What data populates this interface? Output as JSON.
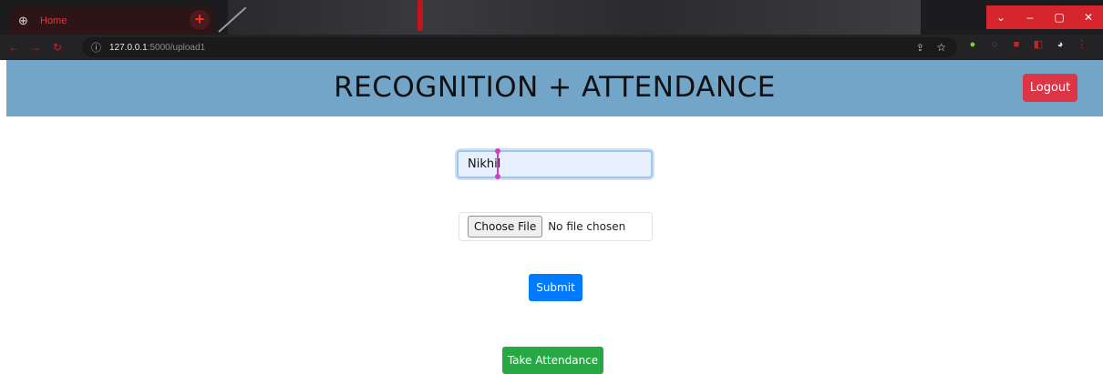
{
  "browser": {
    "tab_title": "Home",
    "tab_close": "×",
    "new_tab": "+",
    "url_host": "127.0.0.1",
    "url_path": ":5000/upload1",
    "window_controls": [
      "⌄",
      "–",
      "▢",
      "✕"
    ],
    "icons": [
      "globe-icon",
      "info-icon",
      "share-icon",
      "star-icon"
    ]
  },
  "header": {
    "title": "RECOGNITION + ATTENDANCE",
    "logout_label": "Logout",
    "background_color": "#72a5c7"
  },
  "form": {
    "name_value": "Nikhil",
    "file_button_label": "Choose File",
    "file_status": "No file chosen",
    "submit_label": "Submit"
  },
  "actions": {
    "take_attendance_label": "Take Attendance"
  },
  "colors": {
    "logout": "#dc3545",
    "submit": "#007bff",
    "take_attendance": "#28a745"
  }
}
